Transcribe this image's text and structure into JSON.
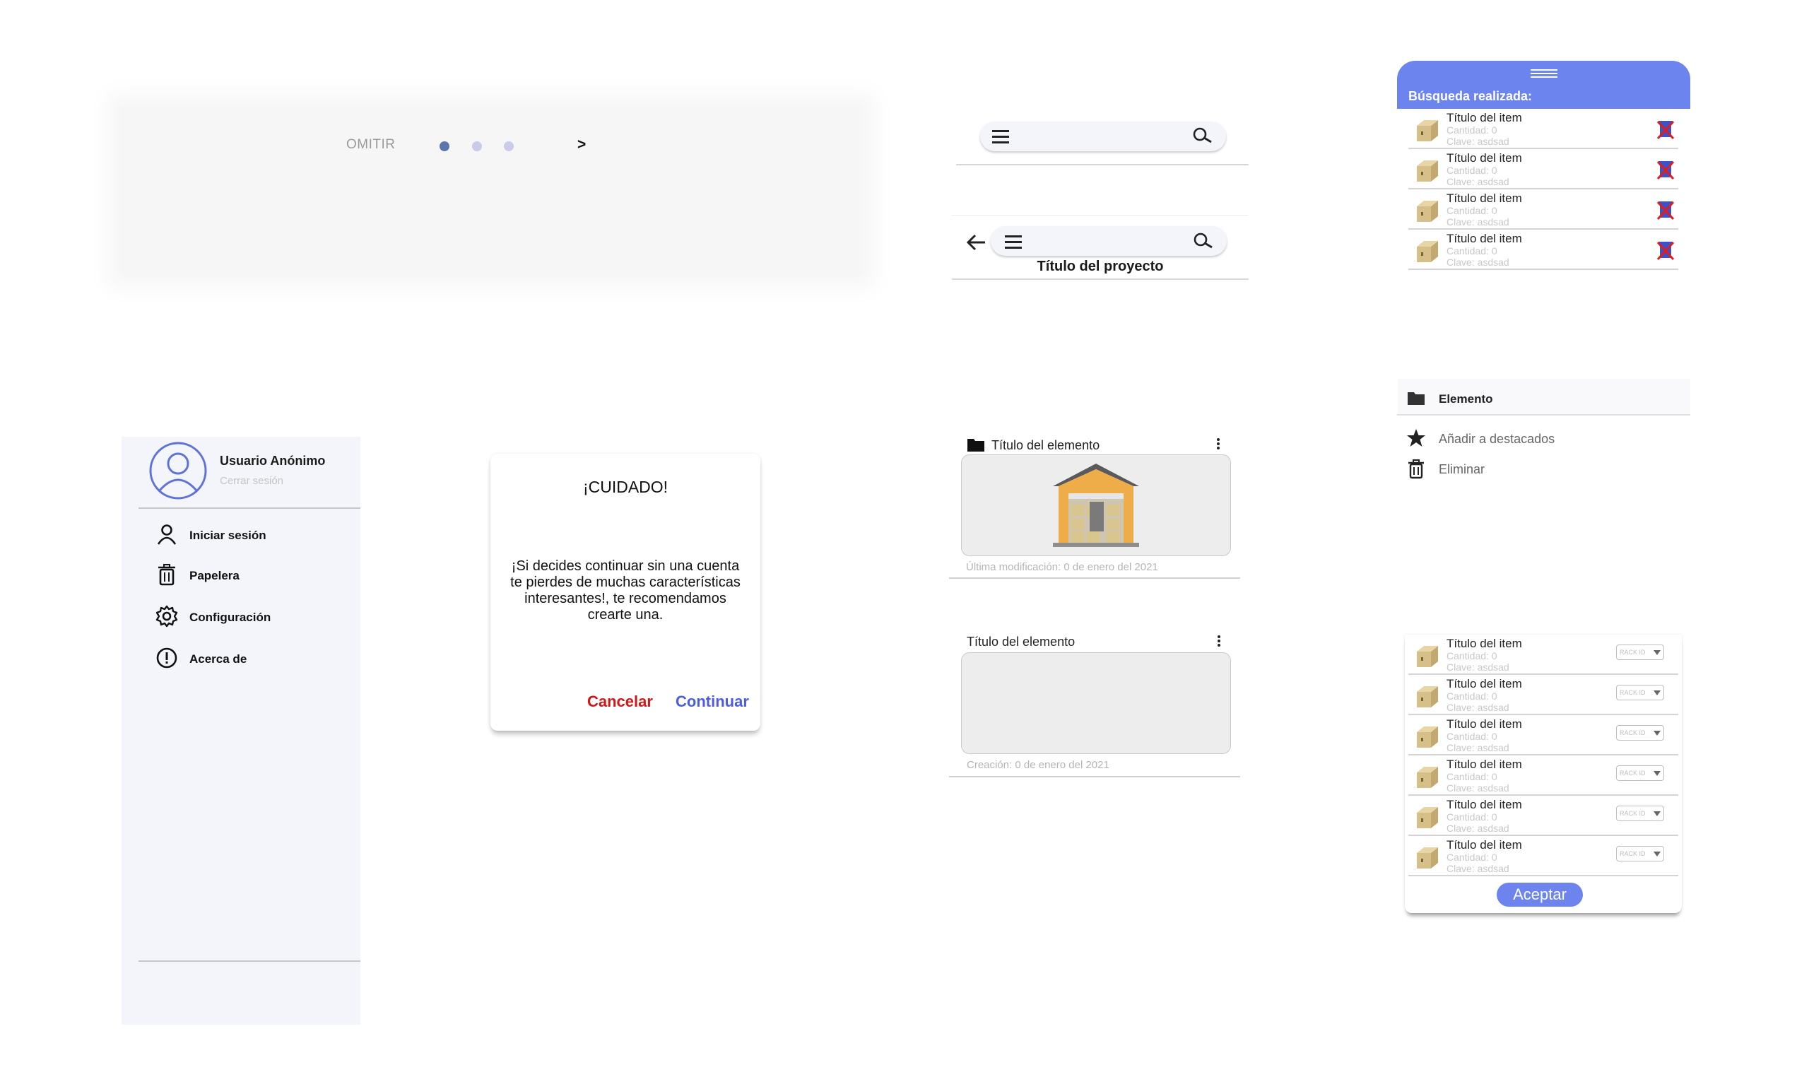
{
  "onboarding": {
    "skip_label": "OMITIR",
    "next_label": ">",
    "dots_total": 3,
    "dots_active": 1
  },
  "search_bar_b": {
    "project_title": "Título del proyecto"
  },
  "search_results": {
    "label": "Búsqueda realizada:",
    "items": [
      {
        "title": "Título del item",
        "quantity": "Cantidad: 0",
        "key": "Clave: asdsad"
      },
      {
        "title": "Título del item",
        "quantity": "Cantidad: 0",
        "key": "Clave: asdsad"
      },
      {
        "title": "Título del item",
        "quantity": "Cantidad: 0",
        "key": "Clave: asdsad"
      },
      {
        "title": "Título del item",
        "quantity": "Cantidad: 0",
        "key": "Clave: asdsad"
      }
    ]
  },
  "drawer": {
    "user_name": "Usuario Anónimo",
    "logout": "Cerrar sesión",
    "items": [
      {
        "label": "Iniciar sesión",
        "icon": "person-icon"
      },
      {
        "label": "Papelera",
        "icon": "trash-icon"
      },
      {
        "label": "Configuración",
        "icon": "gear-icon"
      },
      {
        "label": "Acerca de",
        "icon": "info-icon"
      }
    ]
  },
  "dialog": {
    "title": "¡CUIDADO!",
    "body": "¡Si decides continuar sin una cuenta te pierdes de muchas características interesantes!, te recomendamos crearte una.",
    "cancel_label": "Cancelar",
    "continue_label": "Continuar",
    "cancel_color": "#d01818",
    "continue_color": "#4b5ce6"
  },
  "card_folder": {
    "title": "Título del elemento",
    "meta": "Última modificación: 0 de enero del 2021"
  },
  "card_plain": {
    "title": "Título del elemento",
    "meta": "Creación: 0 de enero del 2021"
  },
  "context_menu": {
    "title": "Elemento",
    "items": [
      {
        "label": "Añadir a destacados",
        "icon": "star-icon"
      },
      {
        "label": "Eliminar",
        "icon": "trash-icon"
      }
    ]
  },
  "rack_panel": {
    "items": [
      {
        "title": "Título del item",
        "quantity": "Cantidad: 0",
        "key": "Clave: asdsad",
        "rack": "RACK ID"
      },
      {
        "title": "Título del item",
        "quantity": "Cantidad: 0",
        "key": "Clave: asdsad",
        "rack": "RACK ID"
      },
      {
        "title": "Título del item",
        "quantity": "Cantidad: 0",
        "key": "Clave: asdsad",
        "rack": "RACK ID"
      },
      {
        "title": "Título del item",
        "quantity": "Cantidad: 0",
        "key": "Clave: asdsad",
        "rack": "RACK ID"
      },
      {
        "title": "Título del item",
        "quantity": "Cantidad: 0",
        "key": "Clave: asdsad",
        "rack": "RACK ID"
      },
      {
        "title": "Título del item",
        "quantity": "Cantidad: 0",
        "key": "Clave: asdsad",
        "rack": "RACK ID"
      }
    ],
    "accept_label": "Aceptar"
  },
  "colors": {
    "accent": "#6c84ee",
    "drawer_bg": "#f4f5fb",
    "danger": "#d01818"
  }
}
